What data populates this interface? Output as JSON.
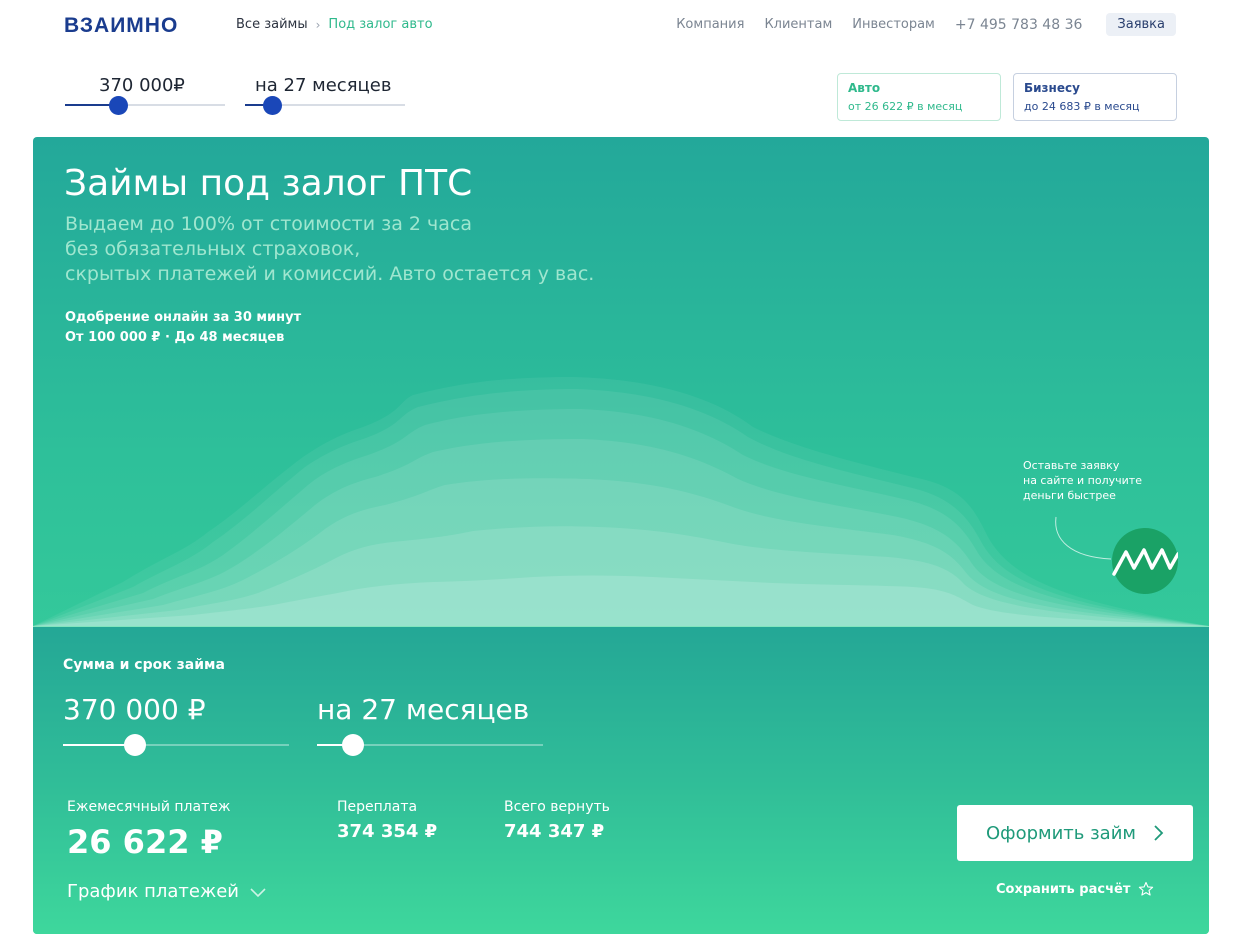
{
  "header": {
    "logo_text": "ВЗАИМНО",
    "breadcrumb": {
      "all": "Все займы",
      "current": "Под залог авто"
    },
    "nav": [
      "Компания",
      "Клиентам",
      "Инвесторам"
    ],
    "phone": "+7 495 783 48 36",
    "apply_label": "Заявка"
  },
  "top_calc": {
    "amount": "370 000₽",
    "amount_fraction": 0.33,
    "term": "на 27 месяцев",
    "term_fraction": 0.17
  },
  "products": [
    {
      "title": "Авто",
      "subtitle": "от 26 622 ₽ в месяц"
    },
    {
      "title": "Бизнесу",
      "subtitle": "до 24 683 ₽ в месяц"
    }
  ],
  "hero": {
    "title": "Займы под залог ПТС",
    "description": [
      "Выдаем до 100% от стоимости за 2  часа",
      "без обязательных страховок,",
      "скрытых платежей и комиссий. Авто остается у вас."
    ],
    "features": [
      "Одобрение онлайн за 30 минут",
      "От 100 000 ₽ · До 48 месяцев"
    ],
    "promo": [
      "Оставьте заявку",
      "на сайте и получите",
      "деньги быстрее"
    ]
  },
  "calculator": {
    "label": "Сумма и срок займа",
    "amount": "370 000 ₽",
    "amount_fraction": 0.32,
    "term": "на 27 месяцев",
    "term_fraction": 0.16,
    "monthly_label": "Ежемесячный платеж",
    "monthly_value": "26 622 ₽",
    "overpay_label": "Переплата",
    "overpay_value": "374 354 ₽",
    "total_label": "Всего вернуть",
    "total_value": "744 347 ₽",
    "schedule_label": "График платежей",
    "cta_label": "Оформить займ",
    "save_label": "Сохранить расчёт"
  },
  "colors": {
    "brand_blue": "#1a47b8",
    "accent_green": "#2fb98c",
    "hero_top": "#23a89a",
    "hero_bottom": "#3ed79c",
    "badge_green": "#1aa266"
  },
  "icons": [
    "chevron-right-icon",
    "chevron-down-icon",
    "star-icon",
    "logo-wave-icon"
  ]
}
